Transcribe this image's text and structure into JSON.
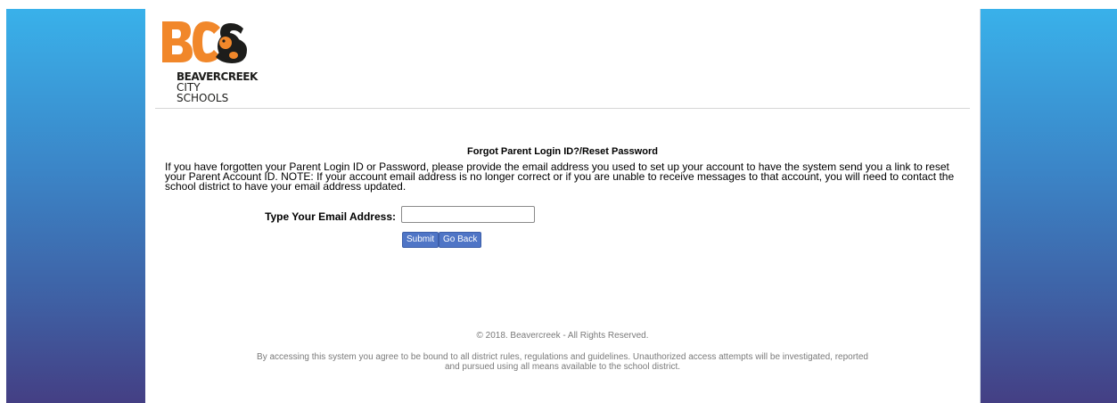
{
  "logo": {
    "letters": "BCS",
    "line1": "BEAVERCREEK",
    "line2": "CITY SCHOOLS",
    "colors": {
      "orange": "#f1872a",
      "dark": "#1d1d1b"
    }
  },
  "form": {
    "title": "Forgot Parent Login ID?/Reset Password",
    "instructions": "If you have forgotten your Parent Login ID or Password, please provide the email address you used to set up your account to have the system send you a link to reset your Parent Account ID. NOTE: If your account email address is no longer correct or if you are unable to receive messages to that account, you will need to contact the school district to have your email address updated.",
    "email_label": "Type Your Email Address:",
    "email_value": "",
    "submit_label": "Submit",
    "goback_label": "Go Back"
  },
  "footer": {
    "copyright": "© 2018. Beavercreek - All Rights Reserved.",
    "disclaimer": "By accessing this system you agree to be bound to all district rules, regulations and guidelines. Unauthorized access attempts will be investigated, reported and pursued using all means available to the school district."
  },
  "colors": {
    "button": "#4f75c6",
    "gradient_top": "#39b1ea",
    "gradient_bottom": "#443f84"
  }
}
